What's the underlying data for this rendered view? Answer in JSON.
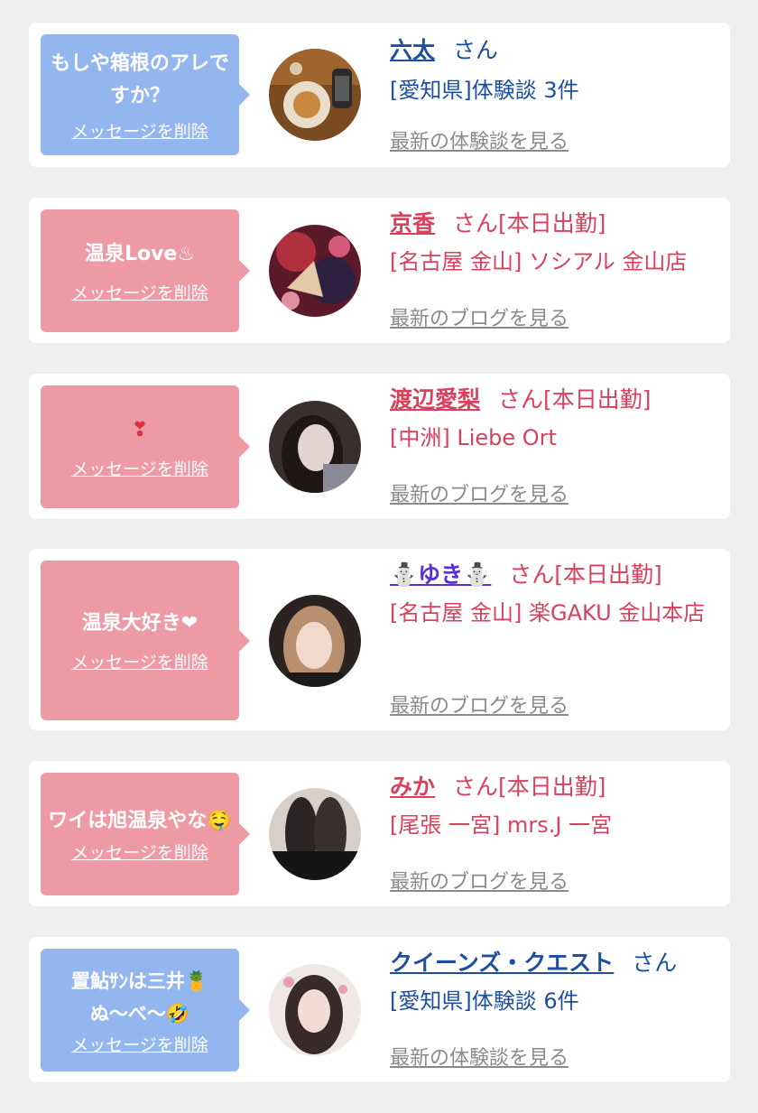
{
  "cards": [
    {
      "message": "もしや箱根のアレですか？",
      "delete_label": "メッセージを削除",
      "name": "六太",
      "honorific": "さん",
      "status": "",
      "shop": "[愛知県]体験談 3件",
      "latest_link": "最新の体験談を見る",
      "theme": "blue"
    },
    {
      "message": "温泉Love♨",
      "delete_label": "メッセージを削除",
      "name": "京香",
      "honorific": "さん",
      "status": "[本日出勤]",
      "shop": "[名古屋 金山] ソシアル 金山店",
      "latest_link": "最新のブログを見る",
      "theme": "pink"
    },
    {
      "message": "❣",
      "delete_label": "メッセージを削除",
      "name": "渡辺愛梨",
      "honorific": "さん",
      "status": "[本日出勤]",
      "shop": "[中洲] Liebe Ort",
      "latest_link": "最新のブログを見る",
      "theme": "pink"
    },
    {
      "message": "温泉大好き❤",
      "delete_label": "メッセージを削除",
      "name": "⛄ゆき⛄",
      "honorific": "さん",
      "status": "[本日出勤]",
      "shop": "[名古屋 金山] 楽GAKU 金山本店",
      "latest_link": "最新のブログを見る",
      "theme": "pink"
    },
    {
      "message": "ワイは旭温泉やな🤤",
      "delete_label": "メッセージを削除",
      "name": "みか",
      "honorific": "さん",
      "status": "[本日出勤]",
      "shop": "[尾張 一宮] mrs.J 一宮",
      "latest_link": "最新のブログを見る",
      "theme": "pink"
    },
    {
      "message": "置鮎ｻﾝは三井🍍ぬ〜べ〜🤣",
      "delete_label": "メッセージを削除",
      "name": "クイーンズ・クエスト",
      "honorific": "さん",
      "status": "",
      "shop": "[愛知県]体験談 6件",
      "latest_link": "最新の体験談を見る",
      "theme": "blue"
    }
  ],
  "colors": {
    "blue_bubble": "#94b6ef",
    "pink_bubble": "#ee9aa5",
    "blue_text": "#1d4f9e",
    "pink_text": "#d9405c",
    "muted_link": "#8a8a8a",
    "page_bg": "#efeff1"
  }
}
